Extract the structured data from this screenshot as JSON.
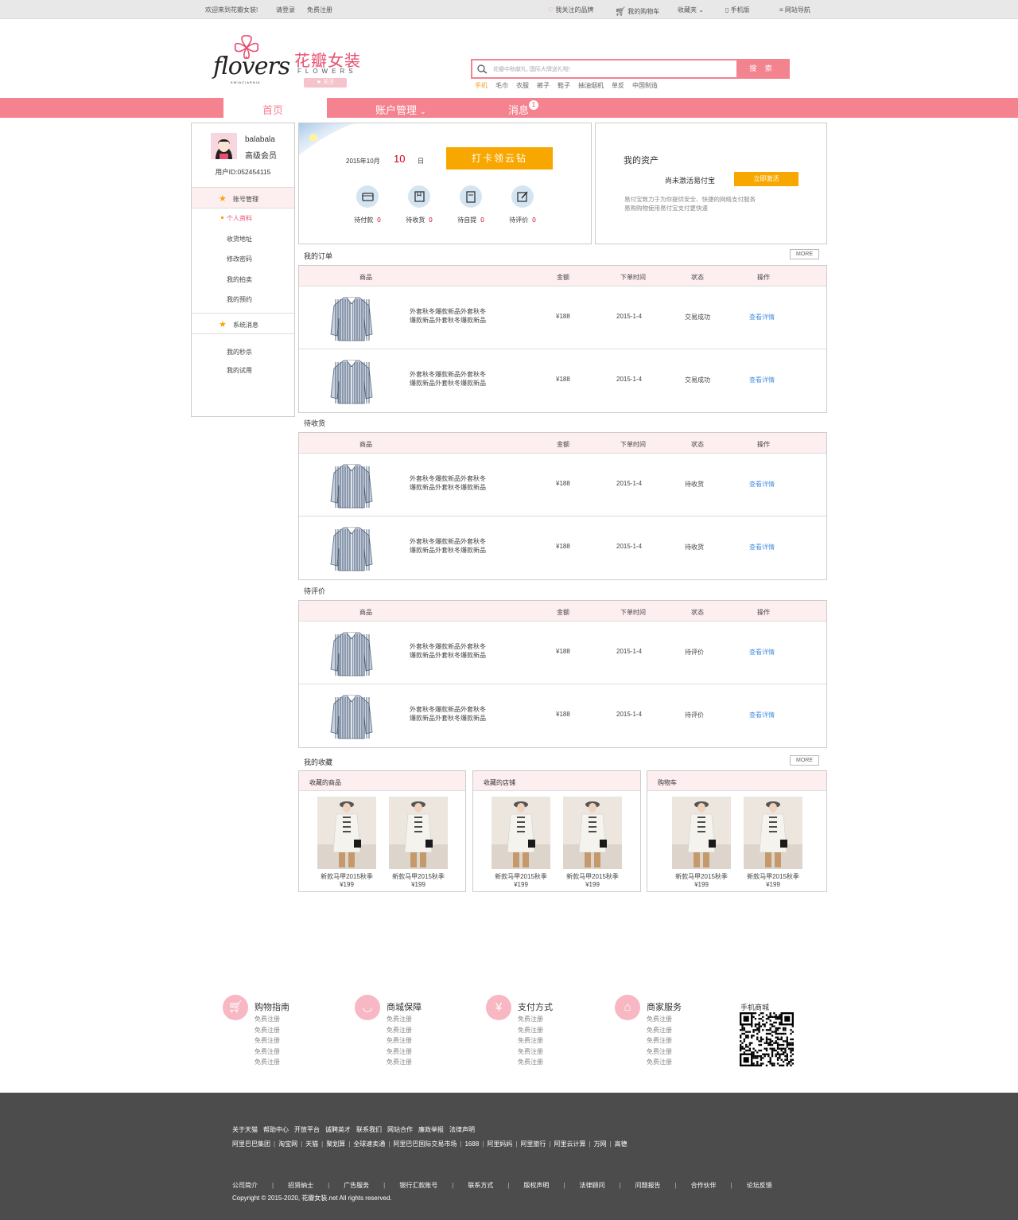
{
  "topbar": {
    "welcome": "欢迎来到花瓣女装!",
    "login": "请登录",
    "register": "免费注册",
    "brands": "我关注的品牌",
    "cart": "我的购物车",
    "favorites": "收藏夹",
    "mobile": "手机版",
    "sitemap": "网站导航"
  },
  "brand": {
    "logo_word": "flovers",
    "logo_sub": "KWIACIARNIA",
    "name_cn": "花瓣女装",
    "name_en": "FLOWERS",
    "follow": "关注"
  },
  "search": {
    "placeholder": "花瓣中秋献礼, 国际大牌送礼啦!",
    "button": "搜 索",
    "hot": [
      "手机",
      "毛巾",
      "衣服",
      "裤子",
      "鞋子",
      "抽油烟机",
      "单反",
      "中国制造"
    ]
  },
  "nav": {
    "home": "首页",
    "account": "账户管理",
    "messages": "消息",
    "message_count": "1"
  },
  "sidebar": {
    "username": "balabala",
    "level": "高级会员",
    "user_id": "用户ID:052454115",
    "section1": "账号管理",
    "links1": [
      "个人资料",
      "收货地址",
      "修改密码",
      "我的拍卖",
      "我的预约"
    ],
    "section2": "系统消息",
    "links2": [
      "我的秒杀",
      "我的试用"
    ]
  },
  "checkin": {
    "date_prefix": "2015年10月",
    "day": "10",
    "day_unit": "日",
    "button": "打卡领云钻",
    "stats": [
      {
        "label": "待付款",
        "count": "0"
      },
      {
        "label": "待收货",
        "count": "0"
      },
      {
        "label": "待自提",
        "count": "0"
      },
      {
        "label": "待评价",
        "count": "0"
      }
    ]
  },
  "assets": {
    "title": "我的资产",
    "status": "尚未激活易付宝",
    "button": "立即激活",
    "desc1": "易付宝致力于为你提供安全、快捷的网络支付服务",
    "desc2": "易购购物使用易付宝支付更快速"
  },
  "table_headers": {
    "product": "商品",
    "amount": "金额",
    "time": "下单时间",
    "status": "状态",
    "action": "操作"
  },
  "more": "MORE",
  "orders": {
    "title": "我的订单",
    "rows": [
      {
        "name1": "外套秋冬爆款新品外套秋冬",
        "name2": "爆款新品外套秋冬爆款新品",
        "price": "¥188",
        "date": "2015-1-4",
        "status": "交易成功",
        "action": "查看详情"
      },
      {
        "name1": "外套秋冬爆款新品外套秋冬",
        "name2": "爆款新品外套秋冬爆款新品",
        "price": "¥188",
        "date": "2015-1-4",
        "status": "交易成功",
        "action": "查看详情"
      }
    ]
  },
  "pending_receive": {
    "title": "待收货",
    "rows": [
      {
        "name1": "外套秋冬爆款新品外套秋冬",
        "name2": "爆款新品外套秋冬爆款新品",
        "price": "¥188",
        "date": "2015-1-4",
        "status": "待收货",
        "action": "查看详情"
      },
      {
        "name1": "外套秋冬爆款新品外套秋冬",
        "name2": "爆款新品外套秋冬爆款新品",
        "price": "¥188",
        "date": "2015-1-4",
        "status": "待收货",
        "action": "查看详情"
      }
    ]
  },
  "pending_review": {
    "title": "待评价",
    "rows": [
      {
        "name1": "外套秋冬爆款新品外套秋冬",
        "name2": "爆款新品外套秋冬爆款新品",
        "price": "¥188",
        "date": "2015-1-4",
        "status": "待评价",
        "action": "查看详情"
      },
      {
        "name1": "外套秋冬爆款新品外套秋冬",
        "name2": "爆款新品外套秋冬爆款新品",
        "price": "¥188",
        "date": "2015-1-4",
        "status": "待评价",
        "action": "查看详情"
      }
    ]
  },
  "favorites": {
    "title": "我的收藏",
    "panels": [
      {
        "title": "收藏的商品",
        "items": [
          {
            "name": "新款马甲2015秋季",
            "price": "¥199"
          },
          {
            "name": "新款马甲2015秋季",
            "price": "¥199"
          }
        ]
      },
      {
        "title": "收藏的店铺",
        "items": [
          {
            "name": "新款马甲2015秋季",
            "price": "¥199"
          },
          {
            "name": "新款马甲2015秋季",
            "price": "¥199"
          }
        ]
      },
      {
        "title": "购物车",
        "items": [
          {
            "name": "新款马甲2015秋季",
            "price": "¥199"
          },
          {
            "name": "新款马甲2015秋季",
            "price": "¥199"
          }
        ]
      }
    ]
  },
  "service": {
    "columns": [
      {
        "title": "购物指南",
        "links": [
          "免费注册",
          "免费注册",
          "免费注册",
          "免费注册",
          "免费注册"
        ]
      },
      {
        "title": "商城保障",
        "links": [
          "免费注册",
          "免费注册",
          "免费注册",
          "免费注册",
          "免费注册"
        ]
      },
      {
        "title": "支付方式",
        "links": [
          "免费注册",
          "免费注册",
          "免费注册",
          "免费注册",
          "免费注册"
        ]
      },
      {
        "title": "商家服务",
        "links": [
          "免费注册",
          "免费注册",
          "免费注册",
          "免费注册",
          "免费注册"
        ]
      }
    ],
    "qr_title": "手机商城"
  },
  "footer": {
    "row1": [
      "关于天猫",
      "帮助中心",
      "开放平台",
      "诚聘英才",
      "联系我们",
      "网站合作",
      "廉政举报",
      "法律声明"
    ],
    "row2": [
      "阿里巴巴集团",
      "淘宝网",
      "天猫",
      "聚划算",
      "全球速卖通",
      "阿里巴巴国际交易市场",
      "1688",
      "阿里妈妈",
      "阿里旅行",
      "阿里云计算",
      "万网",
      "高德"
    ],
    "row3": [
      "公司简介",
      "招贤纳士",
      "广告服务",
      "银行汇款账号",
      "联系方式",
      "版权声明",
      "法律顾问",
      "问题报告",
      "合作伙伴",
      "论坛反馈"
    ],
    "copyright": "Copyright © 2015-2020, 花瓣女装.net All rights reserved."
  },
  "colors": {
    "brand_pink": "#f5828f",
    "accent_orange": "#f8a700",
    "price_red": "#d0021b",
    "link_blue": "#4a90e2"
  }
}
